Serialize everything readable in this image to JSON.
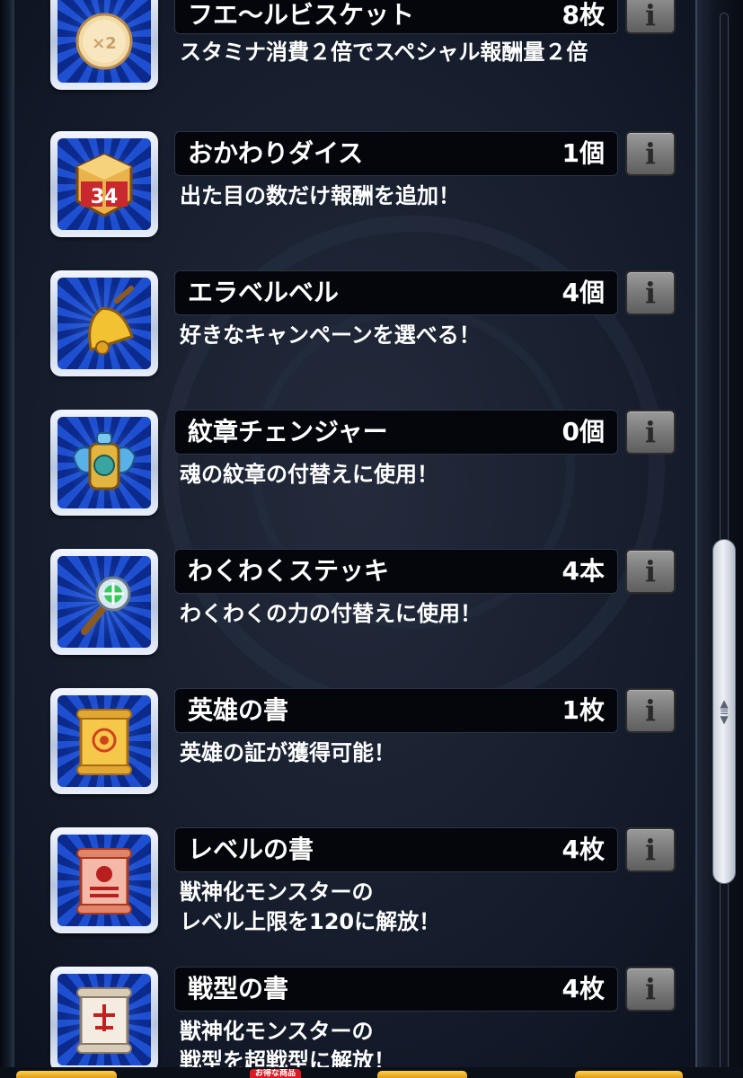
{
  "items": [
    {
      "icon": "biscuit-icon",
      "name": "フエ〜ルビスケット",
      "count": "8枚",
      "desc": [
        "スタミナ消費２倍でスペシャル報酬量２倍"
      ],
      "icon_label": "×2"
    },
    {
      "icon": "dice-icon",
      "name": "おかわりダイス",
      "count": "1個",
      "desc": [
        "出た目の数だけ報酬を追加！"
      ],
      "icon_label": "34"
    },
    {
      "icon": "bell-icon",
      "name": "エラベルベル",
      "count": "4個",
      "desc": [
        "好きなキャンペーンを選べる！"
      ]
    },
    {
      "icon": "emblem-changer-icon",
      "name": "紋章チェンジャー",
      "count": "0個",
      "desc": [
        "魂の紋章の付替えに使用！"
      ]
    },
    {
      "icon": "wand-icon",
      "name": "わくわくステッキ",
      "count": "4本",
      "desc": [
        "わくわくの力の付替えに使用！"
      ]
    },
    {
      "icon": "hero-scroll-icon",
      "name": "英雄の書",
      "count": "1枚",
      "desc": [
        "英雄の証が獲得可能！"
      ]
    },
    {
      "icon": "level-scroll-icon",
      "name": "レベルの書",
      "count": "4枚",
      "desc": [
        "獣神化モンスターの",
        "レベル上限を120に解放！"
      ]
    },
    {
      "icon": "battle-type-scroll-icon",
      "name": "戦型の書",
      "count": "4枚",
      "desc": [
        "獣神化モンスターの",
        "戦型を超戦型に解放！"
      ]
    }
  ],
  "info_button_glyph": "i",
  "bottom_tab_label": "お得な商品",
  "colors": {
    "panel_bg": "#121928",
    "name_bar_bg": "#04060b",
    "text": "#ffffff",
    "icon_blue": "#1e4fd0",
    "info_button": "#8a8a8a",
    "bottom_tab": "#ffd24a",
    "bottom_tab_badge": "#d81b24"
  }
}
